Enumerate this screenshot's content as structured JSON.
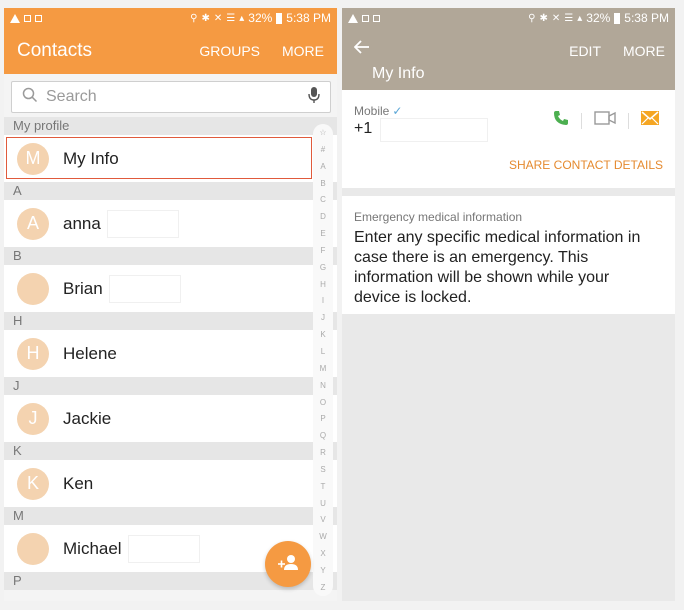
{
  "left": {
    "status": {
      "battery": "32%",
      "time": "5:38 PM"
    },
    "appbar": {
      "title": "Contacts",
      "groups": "GROUPS",
      "more": "MORE"
    },
    "search": {
      "placeholder": "Search"
    },
    "sections": {
      "my_profile": "My profile",
      "A": "A",
      "B": "B",
      "H": "H",
      "J": "J",
      "K": "K",
      "M": "M",
      "P": "P"
    },
    "rows": {
      "myinfo": {
        "initial": "M",
        "name": "My Info"
      },
      "anna": {
        "initial": "A",
        "name": "anna"
      },
      "brian": {
        "name": "Brian"
      },
      "helene": {
        "initial": "H",
        "name": "Helene"
      },
      "jackie": {
        "initial": "J",
        "name": "Jackie"
      },
      "ken": {
        "initial": "K",
        "name": "Ken"
      },
      "michael": {
        "name": "Michael"
      }
    },
    "index": [
      "☆",
      "#",
      "A",
      "B",
      "C",
      "D",
      "E",
      "F",
      "G",
      "H",
      "I",
      "J",
      "K",
      "L",
      "M",
      "N",
      "O",
      "P",
      "Q",
      "R",
      "S",
      "T",
      "U",
      "V",
      "W",
      "X",
      "Y",
      "Z"
    ]
  },
  "right": {
    "status": {
      "battery": "32%",
      "time": "5:38 PM"
    },
    "appbar": {
      "title": "My Info",
      "edit": "EDIT",
      "more": "MORE"
    },
    "mobile": {
      "label": "Mobile",
      "number": "+1"
    },
    "share": "SHARE CONTACT DETAILS",
    "medical": {
      "title": "Emergency medical information",
      "body": "Enter any specific medical information in case there is an emergency. This information will be shown while your device is locked."
    }
  },
  "colors": {
    "accent": "#f59a42",
    "right_bar": "#b1a798",
    "highlight": "#e05a3c"
  },
  "icons": [
    "warning-icon",
    "image-icon",
    "location-icon",
    "bluetooth-icon",
    "mute-icon",
    "wifi-icon",
    "signal-icon",
    "battery-icon",
    "search-icon",
    "mic-icon",
    "back-arrow-icon",
    "phone-icon",
    "video-icon",
    "message-icon",
    "add-contact-icon"
  ]
}
